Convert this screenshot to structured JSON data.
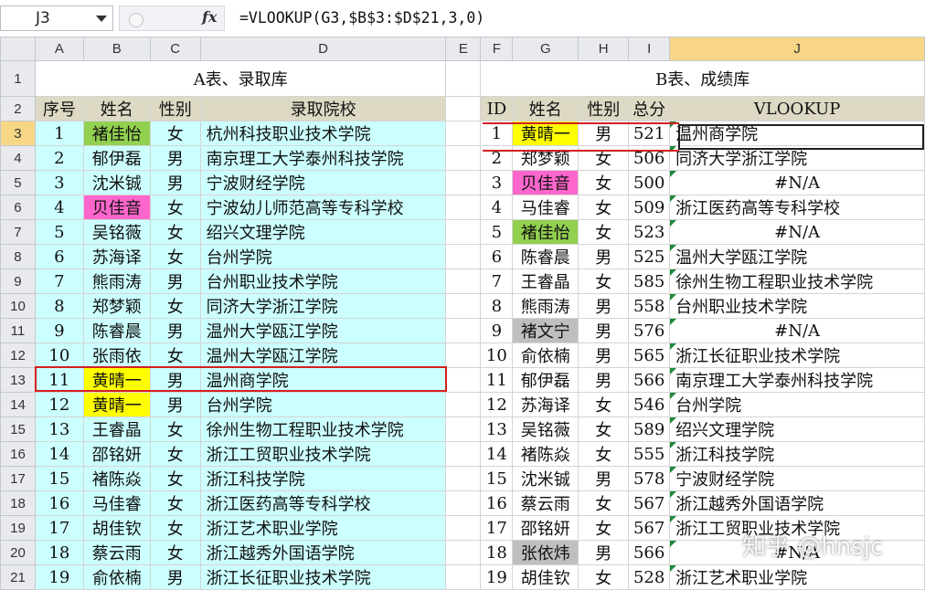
{
  "name_box": "J3",
  "fx": "fx",
  "formula": "=VLOOKUP(G3,$B$3:$D$21,3,0)",
  "columns": [
    "A",
    "B",
    "C",
    "D",
    "E",
    "F",
    "G",
    "H",
    "I",
    "J"
  ],
  "table_a": {
    "title": "A表、录取库",
    "headers": [
      "序号",
      "姓名",
      "性别",
      "录取院校"
    ],
    "rows": [
      [
        "1",
        "褚佳怡",
        "女",
        "杭州科技职业技术学院"
      ],
      [
        "2",
        "郁伊磊",
        "男",
        "南京理工大学泰州科技学院"
      ],
      [
        "3",
        "沈米铖",
        "男",
        "宁波财经学院"
      ],
      [
        "4",
        "贝佳音",
        "女",
        "宁波幼儿师范高等专科学校"
      ],
      [
        "5",
        "吴铭薇",
        "女",
        "绍兴文理学院"
      ],
      [
        "6",
        "苏海译",
        "女",
        "台州学院"
      ],
      [
        "7",
        "熊雨涛",
        "男",
        "台州职业技术学院"
      ],
      [
        "8",
        "郑梦颖",
        "女",
        "同济大学浙江学院"
      ],
      [
        "9",
        "陈睿晨",
        "男",
        "温州大学瓯江学院"
      ],
      [
        "10",
        "张雨依",
        "女",
        "温州大学瓯江学院"
      ],
      [
        "11",
        "黄晴一",
        "男",
        "温州商学院"
      ],
      [
        "12",
        "黄晴一",
        "男",
        "台州学院"
      ],
      [
        "13",
        "王睿晶",
        "女",
        "徐州生物工程职业技术学院"
      ],
      [
        "14",
        "邵铭妍",
        "女",
        "浙江工贸职业技术学院"
      ],
      [
        "15",
        "褚陈焱",
        "女",
        "浙江科技学院"
      ],
      [
        "16",
        "马佳睿",
        "女",
        "浙江医药高等专科学校"
      ],
      [
        "17",
        "胡佳钦",
        "女",
        "浙江艺术职业学院"
      ],
      [
        "18",
        "蔡云雨",
        "女",
        "浙江越秀外国语学院"
      ],
      [
        "19",
        "俞依楠",
        "男",
        "浙江长征职业技术学院"
      ]
    ]
  },
  "table_b": {
    "title": "B表、成绩库",
    "headers": [
      "ID",
      "姓名",
      "性别",
      "总分",
      "VLOOKUP"
    ],
    "rows": [
      [
        "1",
        "黄晴一",
        "男",
        "521",
        "温州商学院"
      ],
      [
        "2",
        "郑梦颖",
        "女",
        "506",
        "同济大学浙江学院"
      ],
      [
        "3",
        "贝佳音",
        "女",
        "500",
        "#N/A"
      ],
      [
        "4",
        "马佳睿",
        "女",
        "509",
        "浙江医药高等专科学校"
      ],
      [
        "5",
        "褚佳怡",
        "女",
        "523",
        "#N/A"
      ],
      [
        "6",
        "陈睿晨",
        "男",
        "525",
        "温州大学瓯江学院"
      ],
      [
        "7",
        "王睿晶",
        "女",
        "585",
        "徐州生物工程职业技术学院"
      ],
      [
        "8",
        "熊雨涛",
        "男",
        "558",
        "台州职业技术学院"
      ],
      [
        "9",
        "褚文宁",
        "男",
        "576",
        "#N/A"
      ],
      [
        "10",
        "俞依楠",
        "男",
        "565",
        "浙江长征职业技术学院"
      ],
      [
        "11",
        "郁伊磊",
        "男",
        "566",
        "南京理工大学泰州科技学院"
      ],
      [
        "12",
        "苏海译",
        "女",
        "546",
        "台州学院"
      ],
      [
        "13",
        "吴铭薇",
        "女",
        "589",
        "绍兴文理学院"
      ],
      [
        "14",
        "褚陈焱",
        "女",
        "555",
        "浙江科技学院"
      ],
      [
        "15",
        "沈米铖",
        "男",
        "578",
        "宁波财经学院"
      ],
      [
        "16",
        "蔡云雨",
        "女",
        "567",
        "浙江越秀外国语学院"
      ],
      [
        "17",
        "邵铭妍",
        "女",
        "567",
        "浙江工贸职业技术学院"
      ],
      [
        "18",
        "张依炜",
        "男",
        "566",
        "#N/A"
      ],
      [
        "19",
        "胡佳钦",
        "女",
        "528",
        "浙江艺术职业学院"
      ]
    ]
  },
  "highlight_colors": {
    "green": "#92d050",
    "yellow": "#ffff00",
    "pink": "#ff66cc",
    "gray": "#bfbfbf",
    "table_a_fill": "#ccffff",
    "header_fill": "#ddd9c4",
    "red_outline": "#d42020"
  },
  "watermark": "知乎 @hnsjc"
}
